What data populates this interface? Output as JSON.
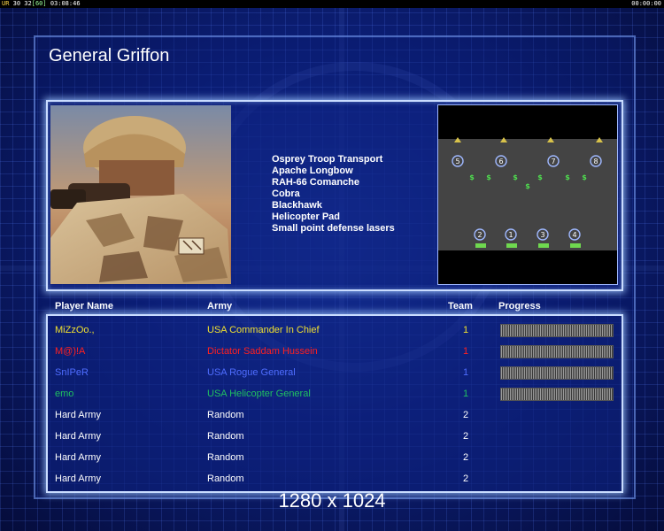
{
  "hud": {
    "ur_label": "UR",
    "ur_values": "30 32",
    "fps": "[60]",
    "clock_left": "03:08:46",
    "clock_right": "00:00:00"
  },
  "title": "General Griffon",
  "units": [
    "Osprey Troop Transport",
    "Apache Longbow",
    "RAH-66 Comanche",
    "Cobra",
    "Blackhawk",
    "Helicopter Pad",
    "Small point defense lasers"
  ],
  "minimap": {
    "top_markers": [
      "5",
      "6",
      "7",
      "8"
    ],
    "bottom_markers": [
      "2",
      "1",
      "3",
      "4"
    ],
    "money_symbol": "$"
  },
  "table": {
    "headers": {
      "player": "Player Name",
      "army": "Army",
      "team": "Team",
      "progress": "Progress"
    },
    "rows": [
      {
        "player": "MiZzOo.,",
        "army": "USA Commander In Chief",
        "team": "1",
        "color": "#f0e030",
        "progress": true
      },
      {
        "player": "M@)!A",
        "army": "Dictator Saddam Hussein",
        "team": "1",
        "color": "#ff2020",
        "progress": true
      },
      {
        "player": "SnIPeR",
        "army": "USA Rogue General",
        "team": "1",
        "color": "#4f6dff",
        "progress": true
      },
      {
        "player": "emo",
        "army": "USA Helicopter General",
        "team": "1",
        "color": "#20c060",
        "progress": true
      },
      {
        "player": "Hard Army",
        "army": "Random",
        "team": "2",
        "color": "#ffffff",
        "progress": false
      },
      {
        "player": "Hard Army",
        "army": "Random",
        "team": "2",
        "color": "#ffffff",
        "progress": false
      },
      {
        "player": "Hard Army",
        "army": "Random",
        "team": "2",
        "color": "#ffffff",
        "progress": false
      },
      {
        "player": "Hard Army",
        "army": "Random",
        "team": "2",
        "color": "#ffffff",
        "progress": false
      }
    ]
  },
  "resolution": "1280 x 1024"
}
